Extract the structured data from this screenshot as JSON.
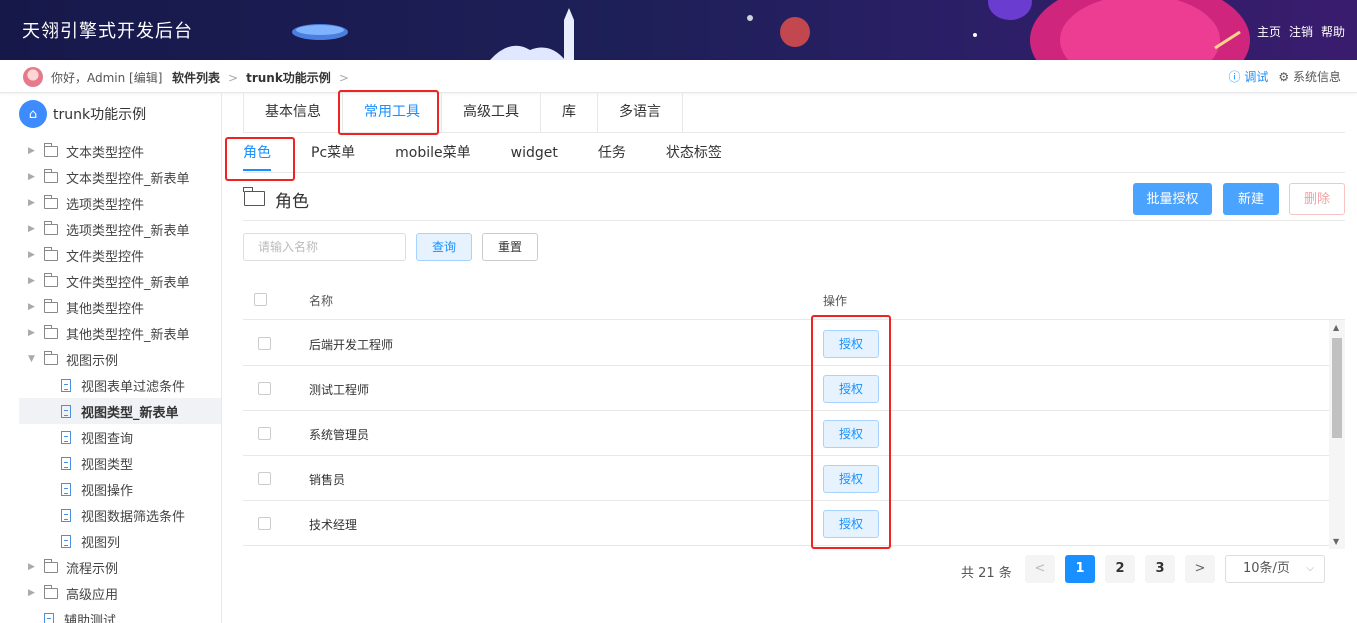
{
  "header": {
    "app_title": "天翎引擎式开发后台",
    "links": [
      "主页",
      "注销",
      "帮助"
    ]
  },
  "breadbar": {
    "greeting": "你好，Admin [编辑]",
    "crumbs": [
      "软件列表",
      "trunk功能示例"
    ],
    "debug_label": "调试",
    "sysinfo_label": "系统信息"
  },
  "sidebar": {
    "root_label": "trunk功能示例",
    "items": [
      {
        "label": "文本类型控件",
        "type": "folder"
      },
      {
        "label": "文本类型控件_新表单",
        "type": "folder"
      },
      {
        "label": "选项类型控件",
        "type": "folder"
      },
      {
        "label": "选项类型控件_新表单",
        "type": "folder"
      },
      {
        "label": "文件类型控件",
        "type": "folder"
      },
      {
        "label": "文件类型控件_新表单",
        "type": "folder"
      },
      {
        "label": "其他类型控件",
        "type": "folder"
      },
      {
        "label": "其他类型控件_新表单",
        "type": "folder"
      },
      {
        "label": "视图示例",
        "type": "folder-open"
      },
      {
        "label": "视图表单过滤条件",
        "type": "doc"
      },
      {
        "label": "视图类型_新表单",
        "type": "doc",
        "selected": true
      },
      {
        "label": "视图查询",
        "type": "doc"
      },
      {
        "label": "视图类型",
        "type": "doc"
      },
      {
        "label": "视图操作",
        "type": "doc"
      },
      {
        "label": "视图数据筛选条件",
        "type": "doc"
      },
      {
        "label": "视图列",
        "type": "doc"
      },
      {
        "label": "流程示例",
        "type": "folder"
      },
      {
        "label": "高级应用",
        "type": "folder"
      },
      {
        "label": "辅助测试",
        "type": "doc"
      }
    ]
  },
  "tabs_primary": [
    "基本信息",
    "常用工具",
    "高级工具",
    "库",
    "多语言"
  ],
  "tabs_primary_active": "常用工具",
  "tabs_secondary": [
    "角色",
    "Pc菜单",
    "mobile菜单",
    "widget",
    "任务",
    "状态标签"
  ],
  "tabs_secondary_active": "角色",
  "section": {
    "title": "角色",
    "batch_grant_label": "批量授权",
    "new_label": "新建",
    "delete_label": "删除"
  },
  "filter": {
    "placeholder": "请输入名称",
    "query_label": "查询",
    "reset_label": "重置"
  },
  "table": {
    "columns": [
      "名称",
      "操作"
    ],
    "rows": [
      {
        "name": "后端开发工程师",
        "action": "授权"
      },
      {
        "name": "测试工程师",
        "action": "授权"
      },
      {
        "name": "系统管理员",
        "action": "授权"
      },
      {
        "name": "销售员",
        "action": "授权"
      },
      {
        "name": "技术经理",
        "action": "授权"
      }
    ]
  },
  "pagination": {
    "total_text": "共 21 条",
    "pages": [
      "1",
      "2",
      "3"
    ],
    "current": "1",
    "page_size": "10条/页"
  },
  "colors": {
    "accent": "#1890ff",
    "header_bg": "#1d1f57",
    "highlight_box": "#f02222"
  }
}
